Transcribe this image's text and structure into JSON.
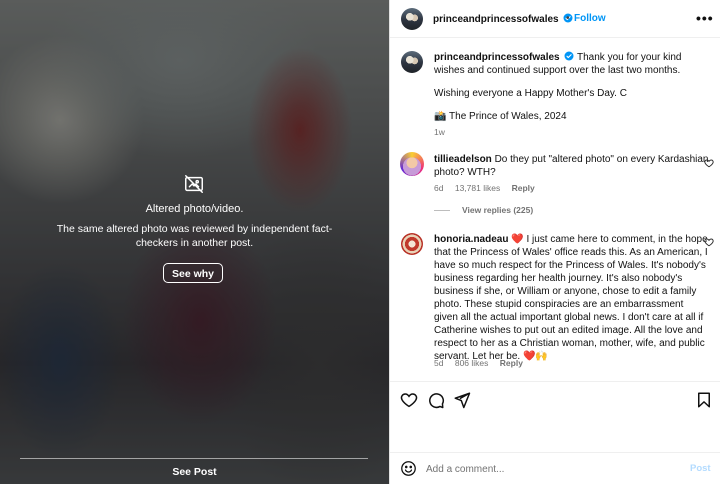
{
  "media": {
    "altered_icon": "image-slash-icon",
    "title": "Altered photo/video.",
    "description": "The same altered photo was reviewed by independent fact-checkers in another post.",
    "see_why_label": "See why",
    "see_post_label": "See Post"
  },
  "header": {
    "username": "princeandprincessofwales",
    "verified": true,
    "separator": "•",
    "follow_label": "Follow",
    "more_label": "•••"
  },
  "caption": {
    "username": "princeandprincessofwales",
    "line1": "Thank you for your kind wishes and continued support over the last two months.",
    "line2": "Wishing everyone a Happy Mother's Day. C",
    "line3": "📸 The Prince of Wales, 2024",
    "time": "1w"
  },
  "comments": [
    {
      "username": "tillieadelson",
      "text": "Do they put \"altered photo\" on every Kardashian photo? WTH?",
      "time": "6d",
      "likes": "13,781 likes",
      "reply_label": "Reply",
      "view_replies": "View replies (225)"
    },
    {
      "username": "honoria.nadeau",
      "text": "❤️ I just came here to comment, in the hope that the Princess of Wales' office reads this. As an American, I have so much respect for the Princess of Wales. It's nobody's business regarding her health journey. It's also nobody's business if she, or William or anyone, chose to edit a family photo. These stupid conspiracies are an embarrassment given all the actual important global news. I don't care at all if Catherine wishes to put out an edited image. All the love and respect to her as a Christian woman, mother, wife, and public servant. Let her be. ❤️🙌",
      "time": "5d",
      "likes": "806 likes",
      "reply_label": "Reply"
    }
  ],
  "actions": {
    "icons": [
      "heart-icon",
      "comment-icon",
      "share-icon",
      "bookmark-icon"
    ]
  },
  "add_comment": {
    "emoji_icon": "emoji-icon",
    "placeholder": "Add a comment...",
    "post_label": "Post"
  },
  "colors": {
    "link_blue": "#0095f6",
    "muted_text": "#737373",
    "verified_blue": "#0095f6"
  }
}
